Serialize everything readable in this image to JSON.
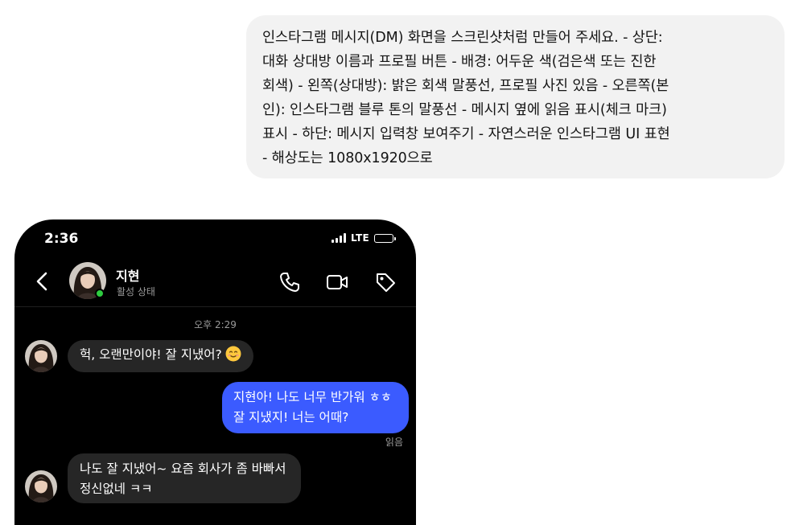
{
  "prompt": {
    "text": "인스타그램 메시지(DM) 화면을 스크린샷처럼 만들어 주세요. - 상단:\n대화 상대방 이름과 프로필 버튼 - 배경: 어두운 색(검은색 또는 진한\n회색) - 왼쪽(상대방): 밝은 회색 말풍선, 프로필 사진 있음 - 오른쪽(본\n인): 인스타그램 블루 톤의 말풍선 - 메시지 옆에 읽음 표시(체크 마크)\n표시 - 하단: 메시지 입력창 보여주기 - 자연스러운 인스타그램 UI 표현\n- 해상도는 1080x1920으로"
  },
  "phone": {
    "status_bar": {
      "time": "2:36",
      "network": "LTE"
    },
    "header": {
      "name": "지현",
      "status": "활성 상태",
      "icons": [
        "back-icon",
        "phone-icon",
        "video-camera-icon",
        "tag-icon"
      ]
    },
    "timestamp": "오후 2:29",
    "messages": [
      {
        "side": "left",
        "text": "헉, 오랜만이야! 잘 지냈어?",
        "emoji": "smiling-face-emoji"
      },
      {
        "side": "right",
        "text": "지현아! 나도 너무 반가워 ㅎㅎ\n잘 지냈지! 너는 어때?"
      },
      {
        "side": "left",
        "text": "나도 잘 지냈어~ 요즘 회사가 좀 바빠서\n정신없네 ㅋㅋ"
      }
    ],
    "read_receipt": "읽음"
  },
  "colors": {
    "phone_background": "#000000",
    "incoming_bubble": "#262626",
    "outgoing_bubble": "#3b5bff",
    "online_indicator": "#2ecc40",
    "prompt_bubble": "#f2f2f2"
  }
}
